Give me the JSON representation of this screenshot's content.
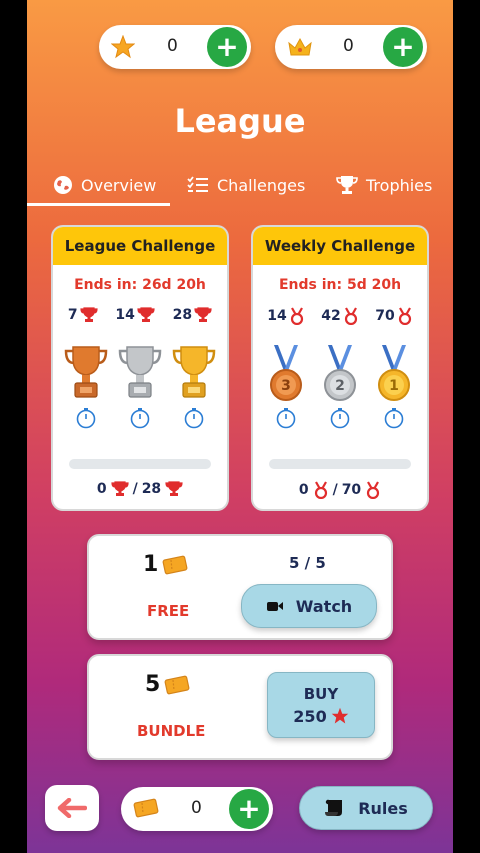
{
  "top_bar": {
    "stars": {
      "icon": "star-icon",
      "count": "0"
    },
    "crowns": {
      "icon": "crown-icon",
      "count": "0"
    },
    "add_symbol": "+"
  },
  "title": "League",
  "tabs": [
    {
      "label": "Overview",
      "icon": "globe-icon",
      "active": true
    },
    {
      "label": "Challenges",
      "icon": "checklist-icon",
      "active": false
    },
    {
      "label": "Trophies",
      "icon": "trophy-icon",
      "active": false
    }
  ],
  "league_card": {
    "title": "League Challenge",
    "ends": "Ends in: 26d 20h",
    "milestones": [
      "7",
      "14",
      "28"
    ],
    "rewards": [
      "bronze-trophy",
      "silver-trophy",
      "gold-trophy"
    ],
    "progress_current": "0",
    "progress_sep": "/",
    "progress_total": "28",
    "progress_fraction": 0
  },
  "weekly_card": {
    "title": "Weekly Challenge",
    "ends": "Ends in: 5d 20h",
    "milestones": [
      "14",
      "42",
      "70"
    ],
    "rewards": [
      "medal-3",
      "medal-2",
      "medal-1"
    ],
    "medal_numbers": [
      "3",
      "2",
      "1"
    ],
    "progress_current": "0",
    "progress_sep": "/",
    "progress_total": "70",
    "progress_fraction": 0
  },
  "free_offer": {
    "qty": "1",
    "label": "FREE",
    "limit": "5 / 5",
    "button": "Watch"
  },
  "bundle_offer": {
    "qty": "5",
    "label": "BUNDLE",
    "buy": "BUY",
    "price": "250"
  },
  "bottom_bar": {
    "tickets": "0",
    "rules": "Rules"
  },
  "colors": {
    "accent_green": "#27a844",
    "header_yellow": "#fec60a",
    "alert_red": "#e23a2c",
    "navy": "#1e2b55",
    "button_blue": "#a8d8e6"
  }
}
